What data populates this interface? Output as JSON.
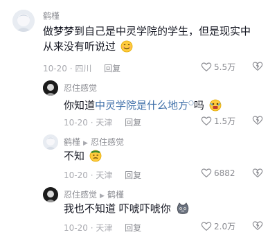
{
  "comments": [
    {
      "user": "鹤槿",
      "text": "做梦梦到自己是中灵学院的学生，但是现实中从来没有听说过",
      "line1": "做梦梦到自己是中灵学院的学生，但是现实中",
      "line2": "从来没有听说过",
      "date": "10-20",
      "location": "四川",
      "reply_label": "回复",
      "likes": "5.5万"
    },
    {
      "user": "忍住感觉",
      "text_prefix": "你知道",
      "link_text": "中灵学院是什么地方",
      "text_suffix": "吗",
      "date": "10-20",
      "location": "天津",
      "reply_label": "回复",
      "likes": "1.5万"
    },
    {
      "user": "鹤槿",
      "reply_to": "忍住感觉",
      "text": "不知",
      "date": "10-20",
      "location": "天津",
      "reply_label": "回复",
      "likes": "6882"
    },
    {
      "user": "忍住感觉",
      "reply_to": "鹤槿",
      "text": "我也不知道 吓唬吓唬你",
      "date": "10-20",
      "location": "天津",
      "reply_label": "回复",
      "likes": "2.0万"
    }
  ],
  "colors": {
    "username": "#8a8b91",
    "meta": "#a9aab0",
    "link": "#3d6ea8"
  },
  "icons": [
    "heart-icon",
    "broken-heart-icon",
    "search-link-icon",
    "smile-emoji",
    "scared-emoji",
    "sweat-emoji",
    "cat-emoji"
  ]
}
